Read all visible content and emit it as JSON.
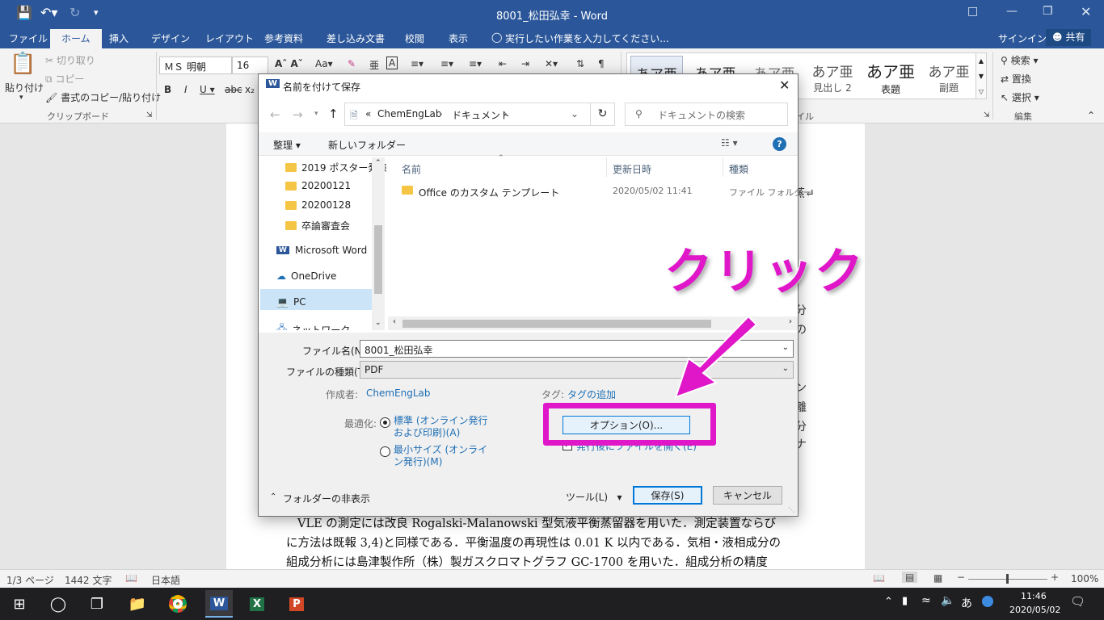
{
  "window": {
    "title": "8001_松田弘幸 - Word"
  },
  "ribbon_tabs": [
    "ファイル",
    "ホーム",
    "挿入",
    "デザイン",
    "レイアウト",
    "参考資料",
    "差し込み文書",
    "校閲",
    "表示"
  ],
  "tell_me": "実行したい作業を入力してください...",
  "signin": "サインイン",
  "share": "共有",
  "clipboard": {
    "paste": "貼り付け",
    "cut": "切り取り",
    "copy": "コピー",
    "format_painter": "書式のコピー/貼り付け",
    "group_label": "クリップボード"
  },
  "font": {
    "name": "ＭＳ 明朝",
    "size": "16"
  },
  "styles": [
    {
      "preview": "あア亜",
      "name": ""
    },
    {
      "preview": "あア亜",
      "name": ""
    },
    {
      "preview": "あア亜",
      "name": ""
    },
    {
      "preview": "あア亜",
      "name": "見出し 2"
    },
    {
      "preview": "あア亜",
      "name": "表題"
    },
    {
      "preview": "あア亜",
      "name": "副題"
    }
  ],
  "styles_label_partial": "イル",
  "editing": {
    "find": "検索",
    "replace": "置換",
    "select": "選択",
    "group_label": "編集"
  },
  "document": {
    "lines": [
      "VLE の測定には改良 Rogalski-Malanowski 型気液平衡蒸留器を用いた．測定装置ならび",
      "に方法は既報 3,4)と同様である．平衡温度の再現性は 0.01 K 以内である．気相・液相成分の",
      "組成分析には島津製作所（株）製ガスクロマトグラフ GC-1700 を用いた．組成分析の精度"
    ],
    "right_fragments": [
      "蒸↵",
      "分",
      "の",
      "ン",
      "離",
      "分",
      "ナ"
    ]
  },
  "statusbar": {
    "page": "1/3 ページ",
    "words": "1442 文字",
    "language": "日本語",
    "zoom": "100%"
  },
  "taskbar": {
    "time": "11:46",
    "date": "2020/05/02",
    "ime": "あ"
  },
  "dialog": {
    "title": "名前を付けて保存",
    "breadcrumb": [
      "ChemEngLab",
      "ドキュメント"
    ],
    "breadcrumb_prefix": "«",
    "search_placeholder": "ドキュメントの検索",
    "organize": "整理",
    "new_folder": "新しいフォルダー",
    "nav_items": [
      "2019 ポスター発表",
      "20200121",
      "20200128",
      "卒論審査会",
      "Microsoft Word",
      "OneDrive",
      "PC",
      "ネットワーク"
    ],
    "columns": {
      "name": "名前",
      "date": "更新日時",
      "type": "種類"
    },
    "files": [
      {
        "name": "Office のカスタム テンプレート",
        "date": "2020/05/02 11:41",
        "type": "ファイル フォルダー"
      }
    ],
    "filename_label": "ファイル名(N):",
    "filename": "8001_松田弘幸",
    "filetype_label": "ファイルの種類(T):",
    "filetype": "PDF",
    "author_label": "作成者:",
    "author": "ChemEngLab",
    "tags_label": "タグ:",
    "tags": "タグの追加",
    "optimize_label": "最適化:",
    "opt_standard": "標準 (オンライン発行および印刷)(A)",
    "opt_minimum": "最小サイズ (オンライン発行)(M)",
    "options_button": "オプション(O)...",
    "open_after": "発行後にファイルを開く(E)",
    "hide_folders": "フォルダーの非表示",
    "tools": "ツール(L)",
    "save": "保存(S)",
    "cancel": "キャンセル"
  },
  "annotation": {
    "text": "クリック",
    "color": "#e016c9"
  }
}
